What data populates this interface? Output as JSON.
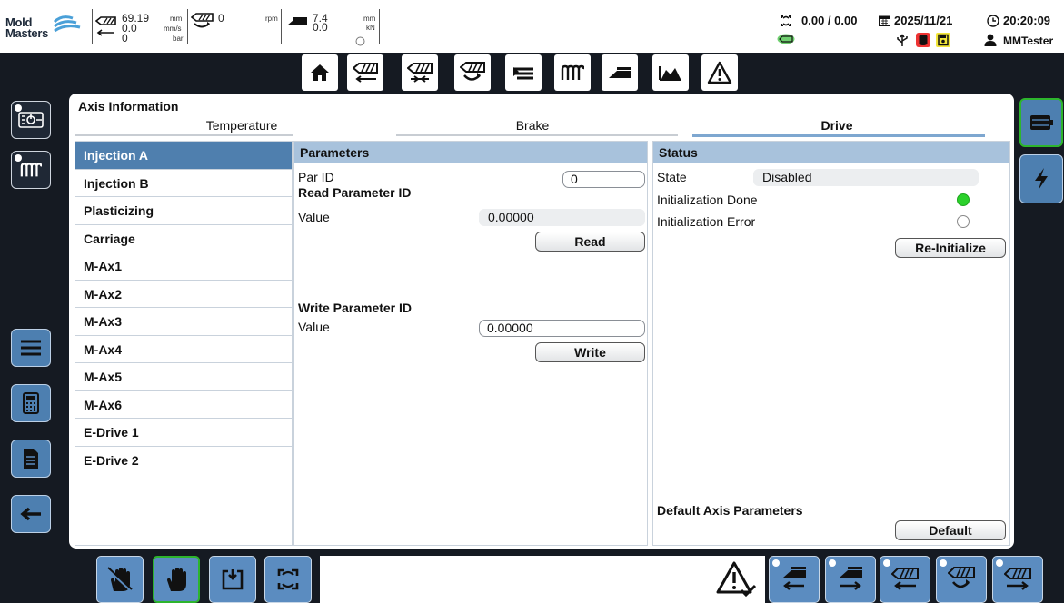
{
  "header": {
    "logo_line1": "Mold",
    "logo_line2": "Masters",
    "injection": {
      "position": "69.19",
      "position_unit": "mm",
      "speed": "0.0",
      "speed_unit": "mm/s",
      "pressure": "0",
      "pressure_unit": "bar"
    },
    "screw": {
      "rpm": "0",
      "rpm_unit": "rpm"
    },
    "clamp": {
      "position": "7.4",
      "position_unit": "mm",
      "force": "0.0",
      "force_unit": "kN"
    },
    "cycle": "0.00 / 0.00",
    "date": "2025/11/21",
    "time": "20:20:09",
    "user": "MMTester"
  },
  "nav": {
    "items": [
      "home-icon",
      "injection-back-icon",
      "injection-icon",
      "screw-rotation-icon",
      "ejector-icon",
      "heater-icon",
      "carriage-icon",
      "graph-icon",
      "warning-icon"
    ]
  },
  "axis_info": {
    "title": "Axis Information",
    "tabs": [
      "Temperature",
      "Brake",
      "Drive"
    ],
    "active_tab": "Drive"
  },
  "axes": [
    "Injection A",
    "Injection B",
    "Plasticizing",
    "Carriage",
    "M-Ax1",
    "M-Ax2",
    "M-Ax3",
    "M-Ax4",
    "M-Ax5",
    "M-Ax6",
    "E-Drive 1",
    "E-Drive 2"
  ],
  "selected_axis": "Injection A",
  "parameters": {
    "title": "Parameters",
    "par_id_label": "Par ID",
    "par_id_value": "0",
    "read_title": "Read Parameter ID",
    "read_value_label": "Value",
    "read_value": "0.00000",
    "read_button": "Read",
    "write_title": "Write Parameter ID",
    "write_value_label": "Value",
    "write_value": "0.00000",
    "write_button": "Write"
  },
  "status": {
    "title": "Status",
    "state_label": "State",
    "state_value": "Disabled",
    "init_done_label": "Initialization Done",
    "init_done": true,
    "init_error_label": "Initialization Error",
    "init_error": false,
    "reinit_button": "Re-Initialize",
    "default_title": "Default Axis Parameters",
    "default_button": "Default"
  },
  "colors": {
    "accent": "#4f7fae",
    "panel_header": "#a8c2dc",
    "led_on": "#2bd12b",
    "active_border": "#2db52d",
    "background": "#151a22"
  }
}
